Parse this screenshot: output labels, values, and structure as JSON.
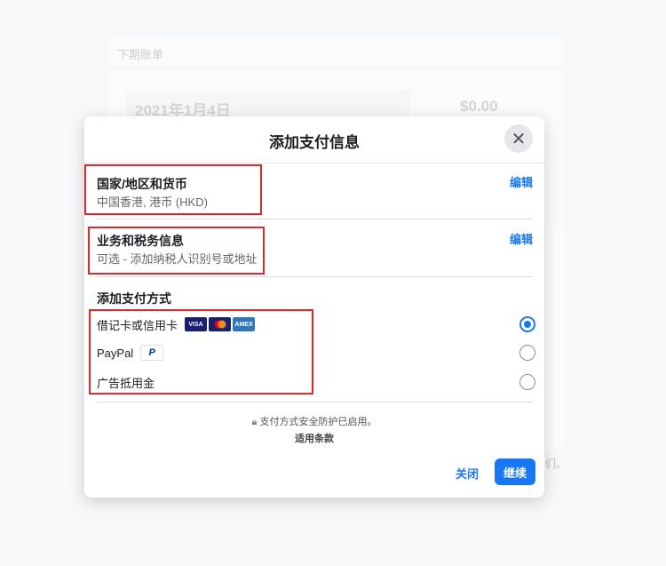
{
  "background": {
    "section_title": "下期账单",
    "date": "2021年1月4日",
    "amount": "$0.00",
    "tail_text": "们。"
  },
  "modal": {
    "title": "添加支付信息",
    "country": {
      "title": "国家/地区和货币",
      "value": "中国香港, 港币 (HKD)",
      "edit": "编辑"
    },
    "tax": {
      "title": "业务和税务信息",
      "value": "可选 - 添加纳税人识别号或地址",
      "edit": "编辑"
    },
    "payment": {
      "title": "添加支付方式",
      "methods": [
        {
          "label": "借记卡或信用卡",
          "selected": true,
          "badges": [
            "VISA",
            "Mastercard",
            "AMEX"
          ]
        },
        {
          "label": "PayPal",
          "selected": false,
          "badges": [
            "P"
          ]
        },
        {
          "label": "广告抵用金",
          "selected": false
        }
      ]
    },
    "security_note": "支付方式安全防护已启用。",
    "terms": "适用条款",
    "close_label": "关闭",
    "continue_label": "继续"
  },
  "colors": {
    "accent": "#1877f2",
    "highlight": "#e0262b"
  }
}
